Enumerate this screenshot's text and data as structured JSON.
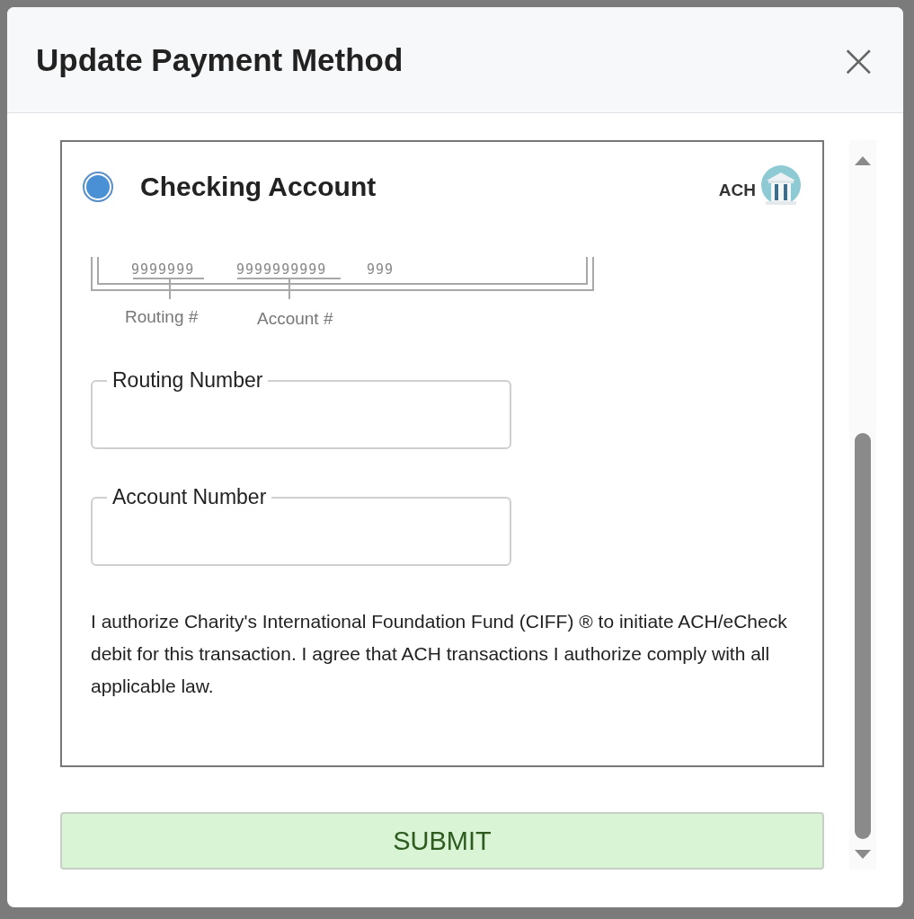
{
  "dialog": {
    "title": "Update Payment Method",
    "close": "×"
  },
  "method": {
    "label": "Checking Account",
    "selected": true,
    "badge": "ACH"
  },
  "check_example": {
    "routing_digits": "9999999",
    "account_digits": "9999999999",
    "check_digits": "999",
    "routing_label": "Routing #",
    "account_label": "Account #"
  },
  "fields": [
    {
      "label": "Routing Number"
    },
    {
      "label": "Account Number"
    }
  ],
  "authorization": "I authorize Charity's International Foundation Fund (CIFF) ® to initiate ACH/eCheck debit for this transaction. I agree that ACH transactions I authorize comply with all applicable law.",
  "submit": "SUBMIT"
}
